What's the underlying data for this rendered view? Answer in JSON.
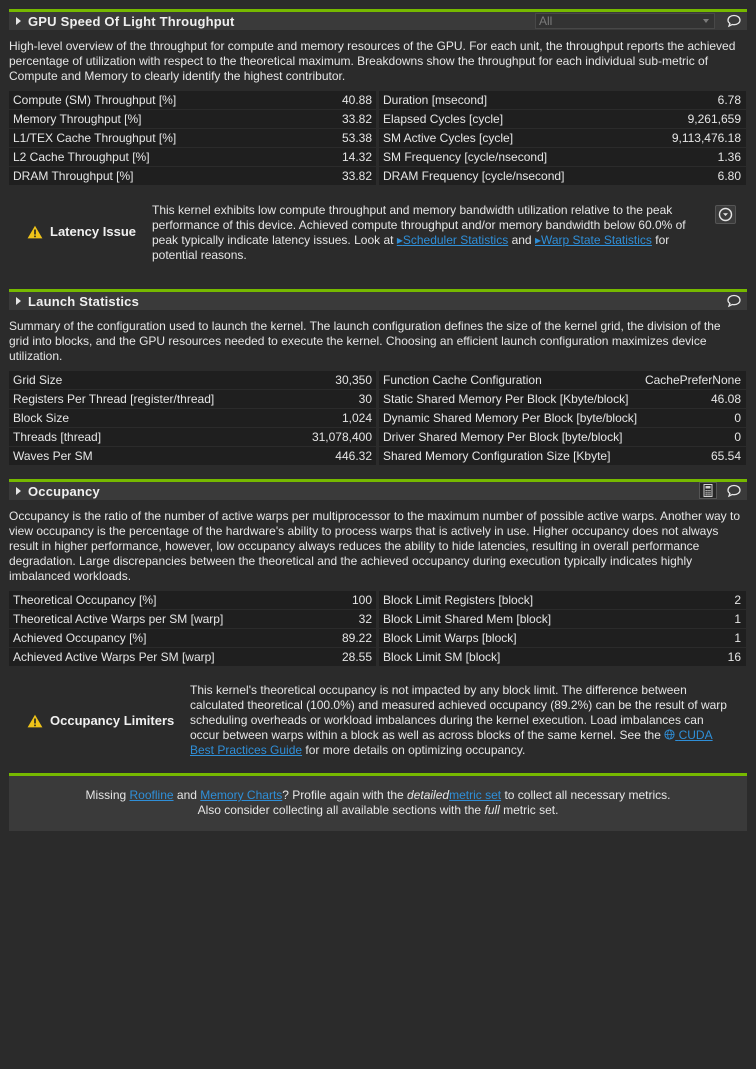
{
  "sections": {
    "sol": {
      "title": "GPU Speed Of Light Throughput",
      "filter_value": "All",
      "description": "High-level overview of the throughput for compute and memory resources of the GPU. For each unit, the throughput reports the achieved percentage of utilization with respect to the theoretical maximum. Breakdowns show the throughput for each individual sub-metric of Compute and Memory to clearly identify the highest contributor.",
      "left": [
        {
          "label": "Compute (SM) Throughput [%]",
          "value": "40.88"
        },
        {
          "label": "Memory Throughput [%]",
          "value": "33.82"
        },
        {
          "label": "L1/TEX Cache Throughput [%]",
          "value": "53.38"
        },
        {
          "label": "L2 Cache Throughput [%]",
          "value": "14.32"
        },
        {
          "label": "DRAM Throughput [%]",
          "value": "33.82"
        }
      ],
      "right": [
        {
          "label": "Duration [msecond]",
          "value": "6.78"
        },
        {
          "label": "Elapsed Cycles [cycle]",
          "value": "9,261,659"
        },
        {
          "label": "SM Active Cycles [cycle]",
          "value": "9,113,476.18"
        },
        {
          "label": "SM Frequency [cycle/nsecond]",
          "value": "1.36"
        },
        {
          "label": "DRAM Frequency [cycle/nsecond]",
          "value": "6.80"
        }
      ],
      "rule": {
        "name": "Latency Issue",
        "text_1": "This kernel exhibits low compute throughput and memory bandwidth utilization relative to the peak performance of this device. Achieved compute throughput and/or memory bandwidth below 60.0% of peak typically indicate latency issues. Look at",
        "link_1": "Scheduler Statistics",
        "text_2": "and",
        "link_2": "Warp State Statistics",
        "text_3": "for potential reasons."
      }
    },
    "launch": {
      "title": "Launch Statistics",
      "description": "Summary of the configuration used to launch the kernel. The launch configuration defines the size of the kernel grid, the division of the grid into blocks, and the GPU resources needed to execute the kernel. Choosing an efficient launch configuration maximizes device utilization.",
      "left": [
        {
          "label": "Grid Size",
          "value": "30,350"
        },
        {
          "label": "Registers Per Thread [register/thread]",
          "value": "30"
        },
        {
          "label": "Block Size",
          "value": "1,024"
        },
        {
          "label": "Threads [thread]",
          "value": "31,078,400"
        },
        {
          "label": "Waves Per SM",
          "value": "446.32"
        }
      ],
      "right": [
        {
          "label": "Function Cache Configuration",
          "value": "CachePreferNone"
        },
        {
          "label": "Static Shared Memory Per Block [Kbyte/block]",
          "value": "46.08"
        },
        {
          "label": "Dynamic Shared Memory Per Block [byte/block]",
          "value": "0"
        },
        {
          "label": "Driver Shared Memory Per Block [byte/block]",
          "value": "0"
        },
        {
          "label": "Shared Memory Configuration Size [Kbyte]",
          "value": "65.54"
        }
      ]
    },
    "occupancy": {
      "title": "Occupancy",
      "description": "Occupancy is the ratio of the number of active warps per multiprocessor to the maximum number of possible active warps. Another way to view occupancy is the percentage of the hardware's ability to process warps that is actively in use. Higher occupancy does not always result in higher performance, however, low occupancy always reduces the ability to hide latencies, resulting in overall performance degradation. Large discrepancies between the theoretical and the achieved occupancy during execution typically indicates highly imbalanced workloads.",
      "left": [
        {
          "label": "Theoretical Occupancy [%]",
          "value": "100"
        },
        {
          "label": "Theoretical Active Warps per SM [warp]",
          "value": "32"
        },
        {
          "label": "Achieved Occupancy [%]",
          "value": "89.22"
        },
        {
          "label": "Achieved Active Warps Per SM [warp]",
          "value": "28.55"
        }
      ],
      "right": [
        {
          "label": "Block Limit Registers [block]",
          "value": "2"
        },
        {
          "label": "Block Limit Shared Mem [block]",
          "value": "1"
        },
        {
          "label": "Block Limit Warps [block]",
          "value": "1"
        },
        {
          "label": "Block Limit SM [block]",
          "value": "16"
        }
      ],
      "rule": {
        "name": "Occupancy Limiters",
        "text_1": "This kernel's theoretical occupancy is not impacted by any block limit. The difference between calculated theoretical (100.0%) and measured achieved occupancy (89.2%) can be the result of warp scheduling overheads or workload imbalances during the kernel execution. Load imbalances can occur between warps within a block as well as across blocks of the same kernel. See the",
        "link_1": "CUDA Best Practices Guide",
        "text_2": "for more details on optimizing occupancy."
      }
    }
  },
  "footer": {
    "missing": "Missing",
    "roofline": "Roofline",
    "and": "and",
    "memory_charts": "Memory Charts",
    "profile_again": "? Profile again with the",
    "detailed": "detailed",
    "metric_set": "metric set",
    "collect": "to collect all necessary metrics.",
    "line2_a": "Also consider collecting all available sections with the",
    "full": "full",
    "line2_b": "metric set."
  },
  "colors": {
    "accent": "#76b900",
    "link": "#2f8fd8",
    "warning": "#f0c419"
  },
  "icons": [
    "expand-arrow-icon",
    "comment-icon",
    "warning-icon",
    "circle-chevron-down-icon",
    "calculator-icon",
    "globe-icon",
    "link-arrow-icon"
  ]
}
